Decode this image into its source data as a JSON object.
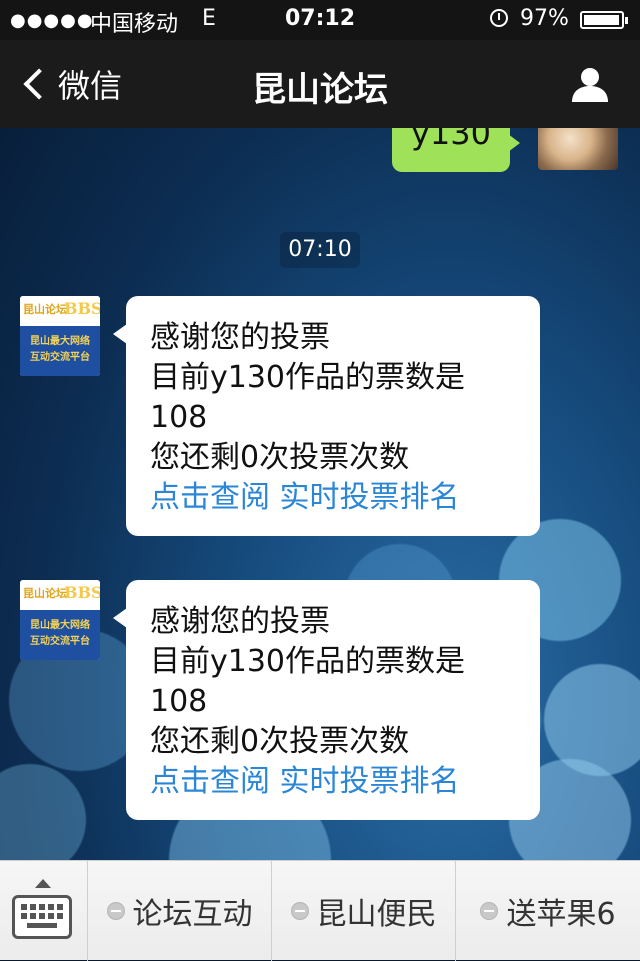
{
  "status_bar": {
    "signal": "●●●●●",
    "carrier": "中国移动",
    "network": "E",
    "time": "07:12",
    "battery_percent": "97%",
    "battery_level": 0.97
  },
  "nav": {
    "back_label": "微信",
    "title": "昆山论坛"
  },
  "chat": {
    "sent_message": "y130",
    "timestamp": "07:10",
    "bot_avatar": {
      "brand": "昆山论坛",
      "bbs": "BBS",
      "line1": "昆山最大网络",
      "line2": "互动交流平台"
    },
    "messages": [
      {
        "line1": "感谢您的投票",
        "line2": "目前y130作品的票数是",
        "line3": "108",
        "line4": "您还剩0次投票次数",
        "link1": "点击查阅",
        "link2": "实时投票排名"
      },
      {
        "line1": "感谢您的投票",
        "line2": "目前y130作品的票数是",
        "line3": "108",
        "line4": "您还剩0次投票次数",
        "link1": "点击查阅",
        "link2": "实时投票排名"
      }
    ]
  },
  "menu": {
    "items": [
      {
        "label": "论坛互动"
      },
      {
        "label": "昆山便民"
      },
      {
        "label": "送苹果6"
      }
    ]
  },
  "colors": {
    "sent_bubble": "#9fe25a",
    "link": "#2b86d6",
    "nav_bg": "#1b1b1c"
  }
}
